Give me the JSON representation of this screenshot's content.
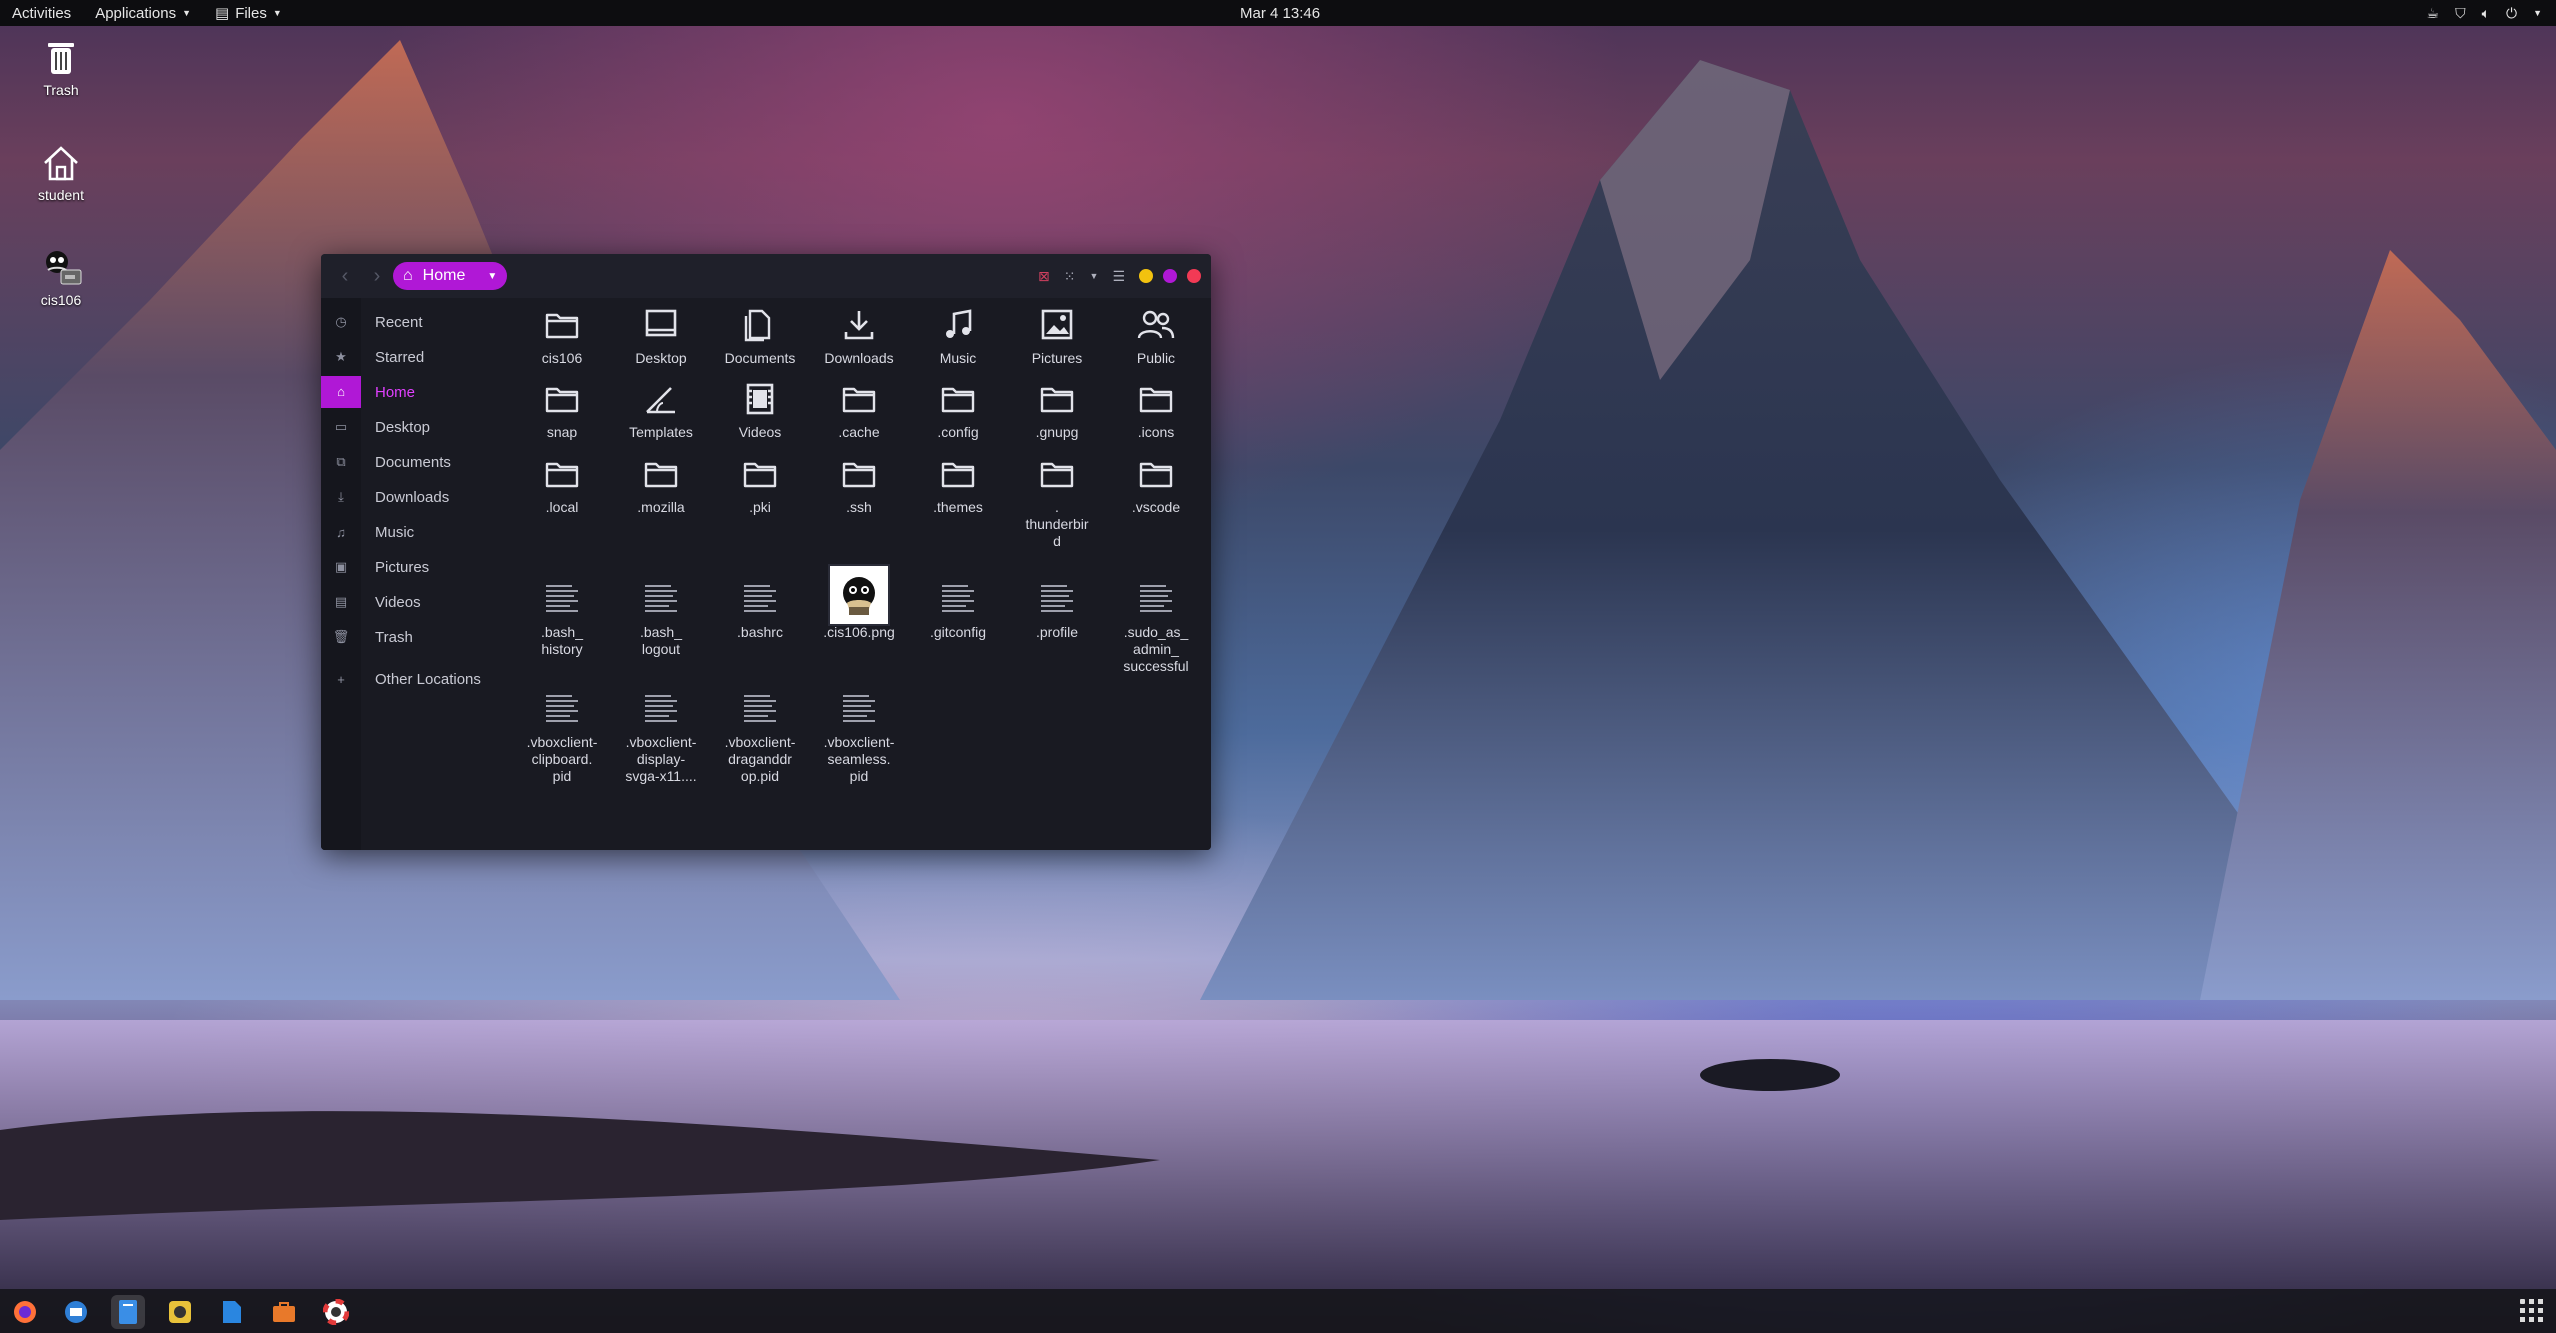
{
  "topbar": {
    "activities": "Activities",
    "applications": "Applications",
    "files_menu": "Files",
    "clock": "Mar 4  13:46"
  },
  "desktop": {
    "icons": [
      {
        "label": "Trash",
        "icon": "trash-icon"
      },
      {
        "label": "student",
        "icon": "home-icon"
      },
      {
        "label": "cis106",
        "icon": "drive-icon"
      }
    ]
  },
  "window": {
    "path": "Home",
    "accent_color": "#b018d6",
    "sidebar": [
      {
        "label": "Recent",
        "icon": "clock-icon",
        "active": false
      },
      {
        "label": "Starred",
        "icon": "star-icon",
        "active": false
      },
      {
        "label": "Home",
        "icon": "home-icon",
        "active": true
      },
      {
        "label": "Desktop",
        "icon": "desktop-icon",
        "active": false
      },
      {
        "label": "Documents",
        "icon": "documents-icon",
        "active": false
      },
      {
        "label": "Downloads",
        "icon": "download-icon",
        "active": false
      },
      {
        "label": "Music",
        "icon": "music-icon",
        "active": false
      },
      {
        "label": "Pictures",
        "icon": "pictures-icon",
        "active": false
      },
      {
        "label": "Videos",
        "icon": "videos-icon",
        "active": false
      },
      {
        "label": "Trash",
        "icon": "trash-icon",
        "active": false
      },
      {
        "label": "Other Locations",
        "icon": "plus-icon",
        "active": false
      }
    ],
    "files": [
      {
        "name": "cis106",
        "type": "folder"
      },
      {
        "name": "Desktop",
        "type": "desktop"
      },
      {
        "name": "Documents",
        "type": "documents"
      },
      {
        "name": "Downloads",
        "type": "downloads"
      },
      {
        "name": "Music",
        "type": "music"
      },
      {
        "name": "Pictures",
        "type": "pictures"
      },
      {
        "name": "Public",
        "type": "public"
      },
      {
        "name": "snap",
        "type": "folder"
      },
      {
        "name": "Templates",
        "type": "templates"
      },
      {
        "name": "Videos",
        "type": "videos"
      },
      {
        "name": ".cache",
        "type": "folder"
      },
      {
        "name": ".config",
        "type": "folder"
      },
      {
        "name": ".gnupg",
        "type": "folder"
      },
      {
        "name": ".icons",
        "type": "folder"
      },
      {
        "name": ".local",
        "type": "folder"
      },
      {
        "name": ".mozilla",
        "type": "folder"
      },
      {
        "name": ".pki",
        "type": "folder"
      },
      {
        "name": ".ssh",
        "type": "folder"
      },
      {
        "name": ".themes",
        "type": "folder"
      },
      {
        "name": ".\nthunderbir\nd",
        "type": "folder"
      },
      {
        "name": ".vscode",
        "type": "folder"
      },
      {
        "name": ".bash_\nhistory",
        "type": "text"
      },
      {
        "name": ".bash_\nlogout",
        "type": "text"
      },
      {
        "name": ".bashrc",
        "type": "text"
      },
      {
        "name": ".cis106.png",
        "type": "image"
      },
      {
        "name": ".gitconfig",
        "type": "text"
      },
      {
        "name": ".profile",
        "type": "text"
      },
      {
        "name": ".sudo_as_\nadmin_\nsuccessful",
        "type": "text"
      },
      {
        "name": ".vboxclient-\nclipboard.\npid",
        "type": "text"
      },
      {
        "name": ".vboxclient-\ndisplay-\nsvga-x11....",
        "type": "text"
      },
      {
        "name": ".vboxclient-\ndraganddr\nop.pid",
        "type": "text"
      },
      {
        "name": ".vboxclient-\nseamless.\npid",
        "type": "text"
      }
    ]
  },
  "dock": [
    {
      "name": "firefox",
      "color": "#ff7139"
    },
    {
      "name": "thunderbird",
      "color": "#2f7fd6"
    },
    {
      "name": "files",
      "color": "#3a8ee6",
      "active": true
    },
    {
      "name": "rhythmbox",
      "color": "#e8c23a"
    },
    {
      "name": "writer",
      "color": "#2a86e0"
    },
    {
      "name": "software",
      "color": "#e8792a"
    },
    {
      "name": "help",
      "color": "#e23a3a"
    }
  ]
}
